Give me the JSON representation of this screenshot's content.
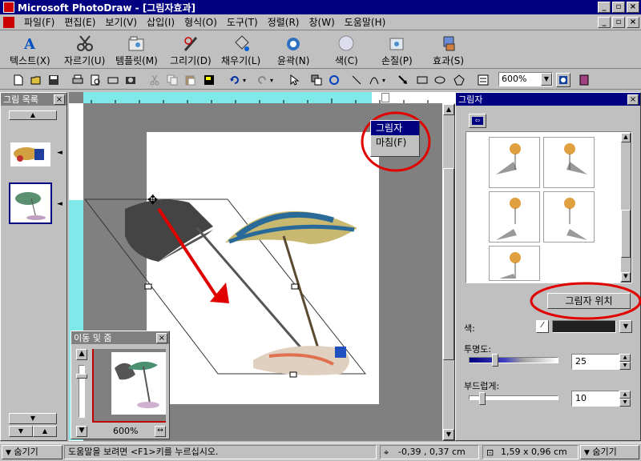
{
  "window": {
    "title": "Microsoft PhotoDraw - [그림자효과]",
    "minimize": "_",
    "restore": "▫",
    "close": "×"
  },
  "menu": [
    "파일(F)",
    "편집(E)",
    "보기(V)",
    "삽입(I)",
    "형식(O)",
    "도구(T)",
    "정렬(R)",
    "창(W)",
    "도움말(H)"
  ],
  "bigtoolbar": [
    {
      "label": "텍스트(X)",
      "icon": "text-icon"
    },
    {
      "label": "자르기(U)",
      "icon": "scissors-icon"
    },
    {
      "label": "템플릿(M)",
      "icon": "template-icon"
    },
    {
      "label": "그리기(D)",
      "icon": "draw-icon"
    },
    {
      "label": "채우기(L)",
      "icon": "fill-icon"
    },
    {
      "label": "윤곽(N)",
      "icon": "outline-icon"
    },
    {
      "label": "색(C)",
      "icon": "color-icon"
    },
    {
      "label": "손질(P)",
      "icon": "touchup-icon"
    },
    {
      "label": "효과(S)",
      "icon": "effects-icon"
    }
  ],
  "zoom": {
    "value": "600%"
  },
  "picture_list": {
    "title": "그림 목록",
    "close": "×"
  },
  "context_menu": {
    "items": [
      "그림자",
      "마침(F)"
    ]
  },
  "zoom_panel": {
    "title": "이동 및 줌",
    "close": "×",
    "zoom_value": "600%"
  },
  "shadow_panel": {
    "title": "그림자",
    "close": "×",
    "position_button": "그림자 위치",
    "color_label": "색:",
    "transparency_label": "투명도:",
    "transparency_value": "25",
    "softness_label": "부드럽게:",
    "softness_value": "10"
  },
  "status": {
    "hide_left": "숨기기",
    "help": "도움말을 보려면 <F1>키를 누르십시오.",
    "coords": "-0,39 , 0,37 cm",
    "size": "1,59 x 0,96 cm",
    "hide_right": "숨기기"
  },
  "colors": {
    "titlebar": "#000080",
    "annotation_red": "#e00000",
    "highlight": "#000080"
  }
}
